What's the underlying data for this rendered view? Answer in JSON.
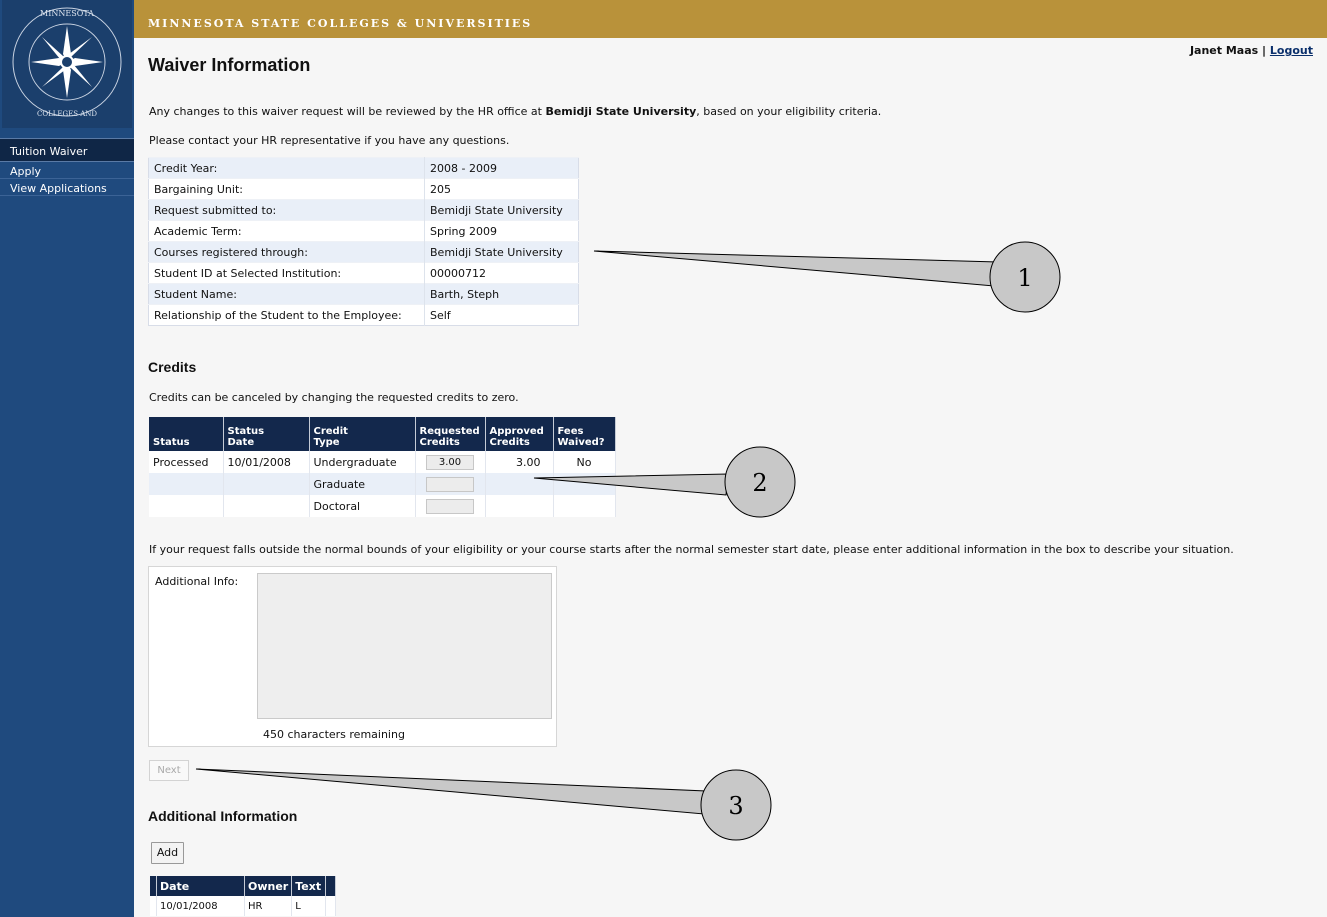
{
  "header": {
    "brand": "MINNESOTA STATE COLLEGES & UNIVERSITIES",
    "user_name": "Janet Maas",
    "separator": "|",
    "logout": "Logout"
  },
  "sidebar": {
    "section": "Tuition Waiver",
    "items": [
      {
        "label": "Apply"
      },
      {
        "label": "View Applications"
      }
    ],
    "logo_icon": "mnscu-seal-icon"
  },
  "page": {
    "title": "Waiver Information",
    "intro_prefix": "Any changes to this waiver request will be reviewed by the HR office at ",
    "intro_school": "Bemidji State University",
    "intro_suffix": ", based on your eligibility criteria.",
    "contact": "Please contact your HR representative if you have any questions."
  },
  "info": [
    {
      "label": "Credit Year:",
      "value": "2008 - 2009"
    },
    {
      "label": "Bargaining Unit:",
      "value": "205"
    },
    {
      "label": "Request submitted to:",
      "value": "Bemidji State University"
    },
    {
      "label": "Academic Term:",
      "value": "Spring 2009"
    },
    {
      "label": "Courses registered through:",
      "value": "Bemidji State University"
    },
    {
      "label": "Student ID at Selected Institution:",
      "value": "00000712"
    },
    {
      "label": "Student Name:",
      "value": "Barth, Steph"
    },
    {
      "label": "Relationship of the Student to the Employee:",
      "value": "Self"
    }
  ],
  "credits": {
    "heading": "Credits",
    "note": "Credits can be canceled by changing the requested credits to zero.",
    "columns": {
      "status": "Status",
      "status_date_1": "Status",
      "status_date_2": "Date",
      "credit_type_1": "Credit",
      "credit_type_2": "Type",
      "requested_1": "Requested",
      "requested_2": "Credits",
      "approved_1": "Approved",
      "approved_2": "Credits",
      "fees_1": "Fees",
      "fees_2": "Waived?"
    },
    "rows": [
      {
        "status": "Processed",
        "date": "10/01/2008",
        "type": "Undergraduate",
        "requested": "3.00",
        "approved": "3.00",
        "fees": "No"
      },
      {
        "status": "",
        "date": "",
        "type": "Graduate",
        "requested": "",
        "approved": "",
        "fees": ""
      },
      {
        "status": "",
        "date": "",
        "type": "Doctoral",
        "requested": "",
        "approved": "",
        "fees": ""
      }
    ]
  },
  "outside_note": "If your request falls outside the normal bounds of your eligibility or your course starts after the normal semester start date, please enter additional information in the box to describe your situation.",
  "additional_box": {
    "label": "Additional Info:",
    "value": "",
    "remaining": "450 characters remaining"
  },
  "next_button": "Next",
  "additional_info": {
    "heading": "Additional Information",
    "add_button": "Add",
    "columns": {
      "date": "Date",
      "owner": "Owner",
      "text": "Text"
    },
    "rows": [
      {
        "date": "10/01/2008",
        "owner": "HR",
        "text": "L"
      }
    ]
  },
  "callouts": [
    {
      "number": "1"
    },
    {
      "number": "2"
    },
    {
      "number": "3"
    }
  ]
}
